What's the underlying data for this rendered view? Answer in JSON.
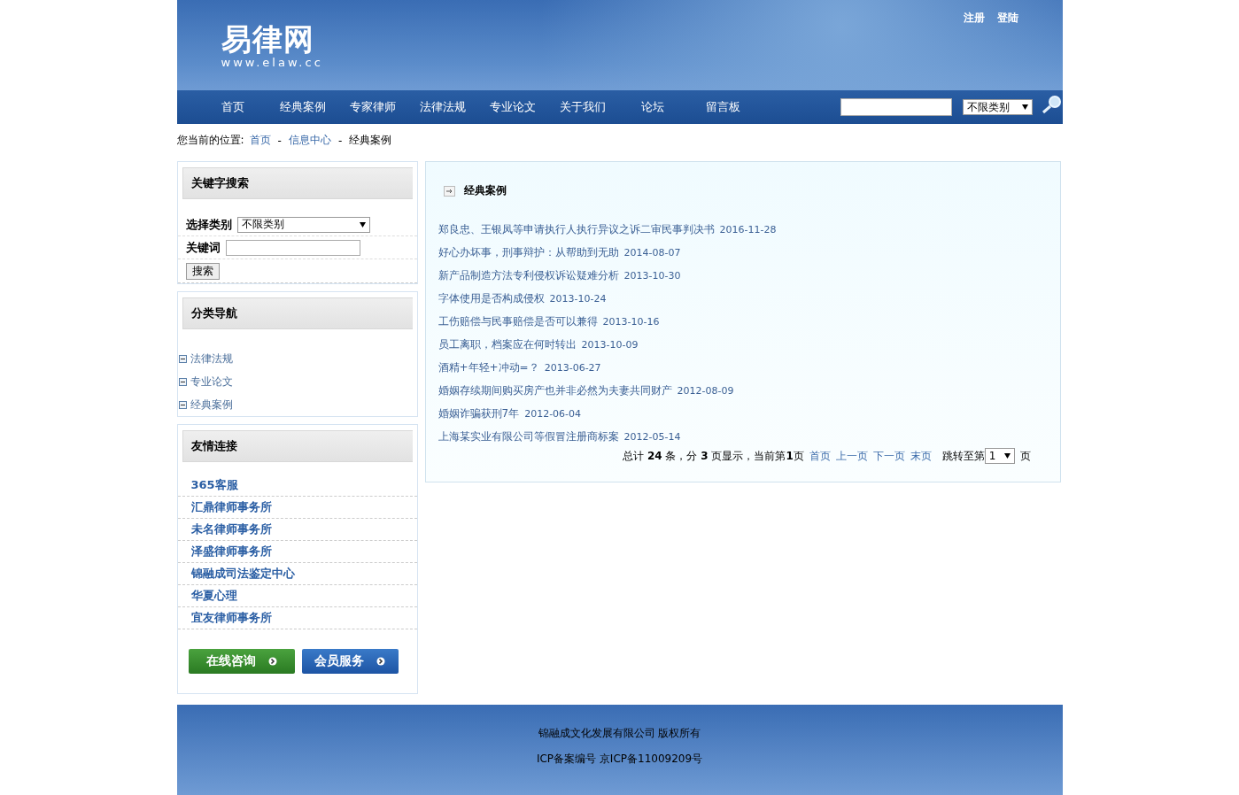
{
  "header": {
    "logo": "易律网",
    "logo_url": "www.elaw.cc",
    "links": [
      "注册",
      "登陆"
    ]
  },
  "nav": {
    "items": [
      "首页",
      "经典案例",
      "专家律师",
      "法律法规",
      "专业论文",
      "关于我们",
      "论坛",
      "留言板"
    ],
    "category": "不限类别"
  },
  "breadcrumb": {
    "label": "您当前的位置:",
    "items": [
      {
        "label": "首页",
        "kind": "link"
      },
      {
        "separator": "-",
        "label": "信息中心",
        "kind": "link"
      },
      {
        "separator": "-",
        "label": "经典案例",
        "kind": "current"
      }
    ]
  },
  "keyword_search": {
    "title": "关键字搜索",
    "category_label": "选择类别",
    "category_value": "不限类别",
    "keyword_label": "关键词",
    "button": "搜索"
  },
  "category_nav": {
    "title": "分类导航",
    "items": [
      "法律法规",
      "专业论文",
      "经典案例"
    ]
  },
  "friend_links": {
    "title": "友情连接",
    "items": [
      "365客服",
      "汇鼎律师事务所",
      "未名律师事务所",
      "泽盛律师事务所",
      "锦融成司法鉴定中心",
      "华夏心理",
      "宜友律师事务所"
    ]
  },
  "side_buttons": [
    {
      "label": "在线咨询",
      "kind": "green"
    },
    {
      "label": "会员服务",
      "kind": "blue"
    }
  ],
  "main": {
    "title": "经典案例",
    "articles": [
      {
        "title": "郑良忠、王银凤等申请执行人执行异议之诉二审民事判决书",
        "date": "2016-11-28"
      },
      {
        "title": "好心办坏事，刑事辩护：从帮助到无助",
        "date": "2014-08-07"
      },
      {
        "title": "新产品制造方法专利侵权诉讼疑难分析",
        "date": "2013-10-30"
      },
      {
        "title": "字体使用是否构成侵权",
        "date": "2013-10-24"
      },
      {
        "title": "工伤赔偿与民事赔偿是否可以兼得",
        "date": "2013-10-16"
      },
      {
        "title": "员工离职，档案应在何时转出",
        "date": "2013-10-09"
      },
      {
        "title": "酒精+年轻+冲动=？",
        "date": "2013-06-27"
      },
      {
        "title": "婚姻存续期间购买房产也并非必然为夫妻共同财产",
        "date": "2012-08-09"
      },
      {
        "title": "婚姻诈骗获刑7年",
        "date": "2012-06-04"
      },
      {
        "title": "上海某实业有限公司等假冒注册商标案",
        "date": "2012-05-14"
      }
    ],
    "pagination": {
      "summary": "总计 **24** 条，分 **3** 页显示，当前第**1**页",
      "links": [
        "首页",
        "上一页",
        "下一页",
        "末页"
      ],
      "jump_label": "跳转至第",
      "jump_value": "1",
      "page_suffix": "页"
    }
  },
  "footer": {
    "lines": [
      "锦融成文化发展有限公司 版权所有",
      "ICP备案编号 京ICP备11009209号"
    ]
  }
}
